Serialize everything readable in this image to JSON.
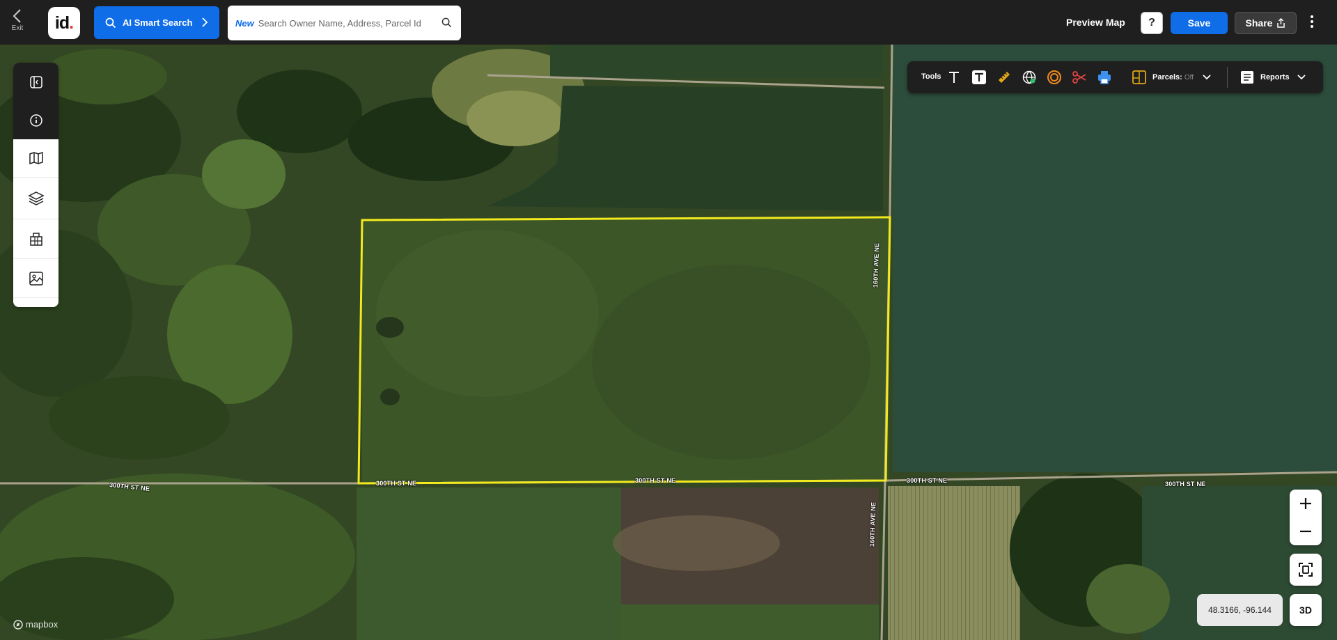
{
  "header": {
    "exit_label": "Exit",
    "logo_text": "id",
    "logo_dot": ".",
    "ai_search_label": "AI Smart Search",
    "search_badge": "New",
    "search_placeholder": "Search Owner Name, Address, Parcel Id",
    "preview_map_label": "Preview Map",
    "help_label": "?",
    "save_label": "Save",
    "share_label": "Share"
  },
  "sidebar": {
    "items": [
      {
        "icon": "panel-toggle-icon"
      },
      {
        "icon": "info-icon"
      },
      {
        "icon": "map-icon"
      },
      {
        "icon": "layers-icon"
      },
      {
        "icon": "buildings-icon"
      },
      {
        "icon": "image-icon"
      }
    ]
  },
  "tools": {
    "label": "Tools",
    "items": [
      "text-tool-icon",
      "text-box-tool-icon",
      "ruler-icon",
      "globe-measure-icon",
      "radius-icon",
      "scissors-icon",
      "print-icon"
    ],
    "parcels_label": "Parcels:",
    "parcels_value": "Off",
    "reports_label": "Reports"
  },
  "map": {
    "road_labels": {
      "road_300th_west": "300TH ST NE",
      "road_300th_parcel_left": "300TH ST NE",
      "road_300th_parcel_mid": "300TH ST NE",
      "road_300th_east1": "300TH ST NE",
      "road_300th_east2": "300TH ST NE",
      "road_160th_north": "160TH AVE NE",
      "road_160th_south": "160TH AVE NE"
    },
    "coordinates": "48.3166, -96.144",
    "button_3d": "3D",
    "attribution": "mapbox",
    "highlight_color": "#f2ea1d"
  }
}
